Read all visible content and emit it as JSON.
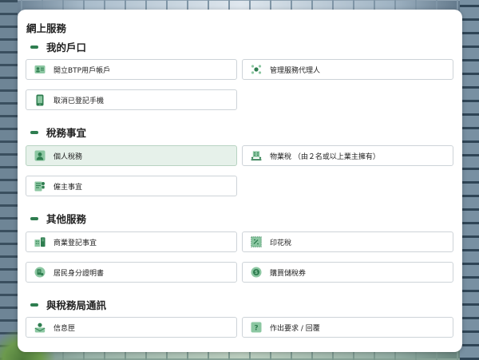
{
  "panel": {
    "title": "網上服務"
  },
  "sections": [
    {
      "label": "我的戶口",
      "items": [
        {
          "label": "開立BTP用戶帳戶",
          "icon": "id-card-icon"
        },
        {
          "label": "管理服務代理人",
          "icon": "people-network-icon"
        },
        {
          "label": "取消已登記手機",
          "icon": "mobile-phone-icon"
        }
      ]
    },
    {
      "label": "稅務事宜",
      "items": [
        {
          "label": "個人稅務",
          "icon": "person-icon",
          "selected": true
        },
        {
          "label": "物業稅 （由２名或以上業主擁有）",
          "icon": "building-people-icon"
        },
        {
          "label": "僱主事宜",
          "icon": "employer-form-icon"
        }
      ]
    },
    {
      "label": "其他服務",
      "items": [
        {
          "label": "商業登記事宜",
          "icon": "business-registration-icon"
        },
        {
          "label": "印花稅",
          "icon": "stamp-duty-icon"
        },
        {
          "label": "居民身分證明書",
          "icon": "resident-certificate-icon"
        },
        {
          "label": "購買儲稅券",
          "icon": "tax-reserve-coin-icon"
        }
      ]
    },
    {
      "label": "與稅務局通訊",
      "items": [
        {
          "label": "信息匣",
          "icon": "inbox-person-icon"
        },
        {
          "label": "作出要求 / 回覆",
          "icon": "request-reply-icon"
        }
      ]
    }
  ],
  "colors": {
    "accent": "#2e7d4f",
    "accent_light": "#8cc7a2",
    "selected_bg": "#e6f1ea"
  }
}
